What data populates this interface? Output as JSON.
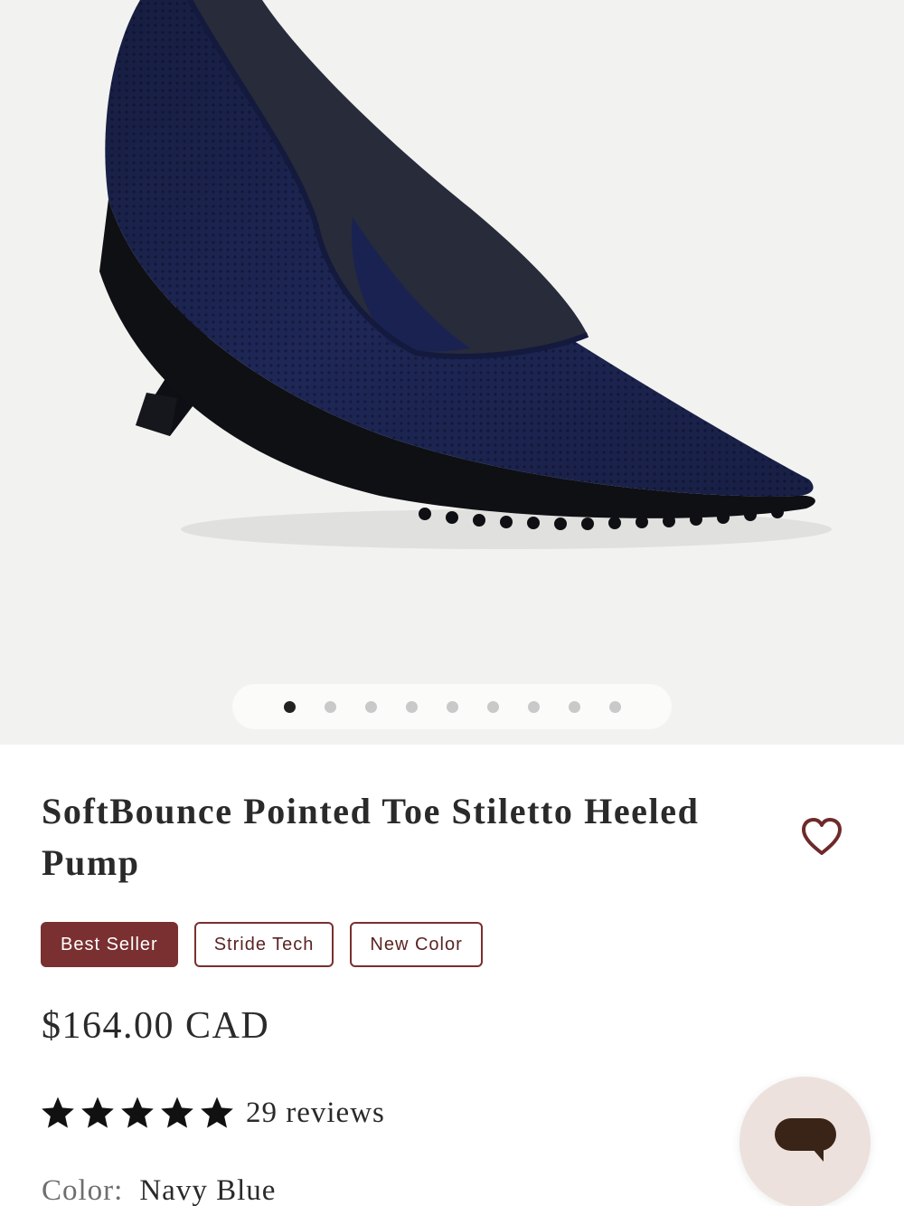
{
  "gallery": {
    "image_alt": "Navy knit pointed toe stiletto pump",
    "slide_count": 9,
    "active_slide": 1
  },
  "product": {
    "title": "SoftBounce Pointed Toe Stiletto Heeled Pump",
    "badges": [
      "Best Seller",
      "Stride Tech",
      "New Color"
    ],
    "price": "$164.00 CAD",
    "rating": 5,
    "reviews_label": "29 reviews",
    "color_label": "Color:",
    "color_value": "Navy Blue"
  },
  "icons": {
    "wishlist": "heart-outline-icon",
    "star": "star-icon",
    "chat": "chat-bubble-icon"
  },
  "colors": {
    "accent": "#7a3030",
    "image_bg": "#f2f2f0",
    "shoe": "#1c2452",
    "chat_bg": "#ece1dc",
    "chat_icon": "#3a2417"
  }
}
